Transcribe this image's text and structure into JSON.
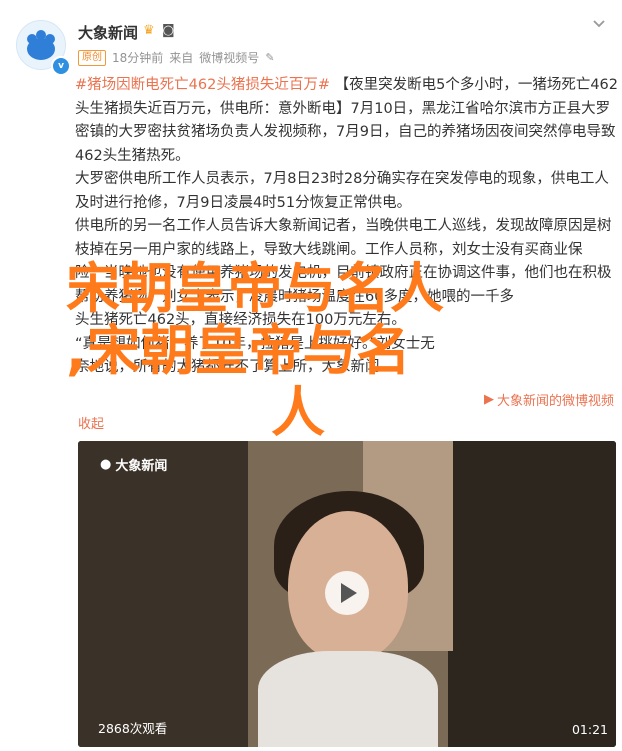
{
  "header": {
    "username": "大象新闻",
    "time": "18分钟前",
    "source_prefix": "来自",
    "source": "微博视频号",
    "tag": "原创",
    "vbadge": "v"
  },
  "content": {
    "hashtag": "#猪场因断电死亡462头猪损失近百万#",
    "p1": "【夜里突发断电5个多小时，一猪场死亡462头生猪损失近百万元，供电所：意外断电】7月10日，黑龙江省哈尔滨市方正县大罗密镇的大罗密扶贫猪场负责人发视频称，7月9日，自己的养猪场因夜间突然停电导致462头生猪热死。",
    "p2": "大罗密供电所工作人员表示，7月8日23时28分确实存在突发停电的现象，供电工人及时进行抢修，7月9日凌晨4时51分恢复正常供电。",
    "p3": "供电所的另一名工作人员告诉大象新闻记者，当晚供电工人巡线，发现故障原因是树枝掉在另一用户家的线路上，导致大线跳闸。工作人员称，刘女士没有买商业保",
    "p4": "险，当晚她也没有使用养猪场的发电机，目前镇政府正在协调这件事，他们也在积极",
    "p5": "帮助养猪场。刘女士表示，凌晨时猪场温度在60多度，她喂的一千多",
    "p6": "头生猪死亡462头，直接经济损失在100万元左右。",
    "p7": "“真是想如何猪，养了10年，拉猪是上挑好好。”刘女士无",
    "p8": "奈地说，所有的大猪都开不了算上所，大象新闻",
    "collapse": "收起",
    "video_link": "大象新闻的微博视频"
  },
  "video": {
    "logo": "大象新闻",
    "views": "2868次观看",
    "duration": "01:21"
  },
  "overlay": {
    "line1": "宋朝皇帝与名人",
    "line2": ",宋朝皇帝与名",
    "line3": "人"
  },
  "colors": {
    "accent": "#eb7350",
    "overlay": "#ff7a1a",
    "vip": "#2f8fe0"
  },
  "icons": {
    "chevron": "chevron-down-icon",
    "play": "play-icon",
    "video": "video-icon"
  }
}
